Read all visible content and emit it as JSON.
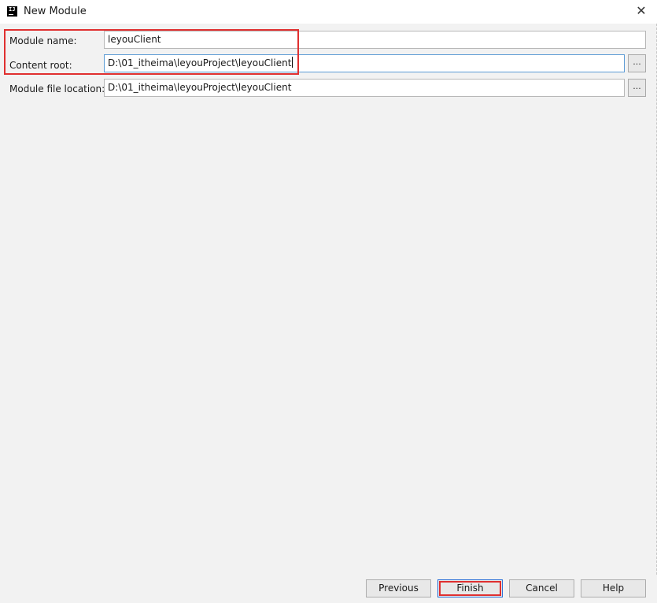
{
  "window": {
    "title": "New Module",
    "app_icon_text": "IJ",
    "close_glyph": "✕"
  },
  "form": {
    "module_name_label": "Module name:",
    "module_name_value": "leyouClient",
    "content_root_label": "Content root:",
    "content_root_value": "D:\\01_itheima\\leyouProject\\leyouClient",
    "module_file_location_label": "Module file location:",
    "module_file_location_value": "D:\\01_itheima\\leyouProject\\leyouClient",
    "browse_label": "..."
  },
  "buttons": {
    "previous": "Previous",
    "finish": "Finish",
    "cancel": "Cancel",
    "help": "Help"
  },
  "colors": {
    "highlight": "#e03030",
    "focus": "#5b9bd5",
    "default_button_border": "#2a6fd6"
  }
}
